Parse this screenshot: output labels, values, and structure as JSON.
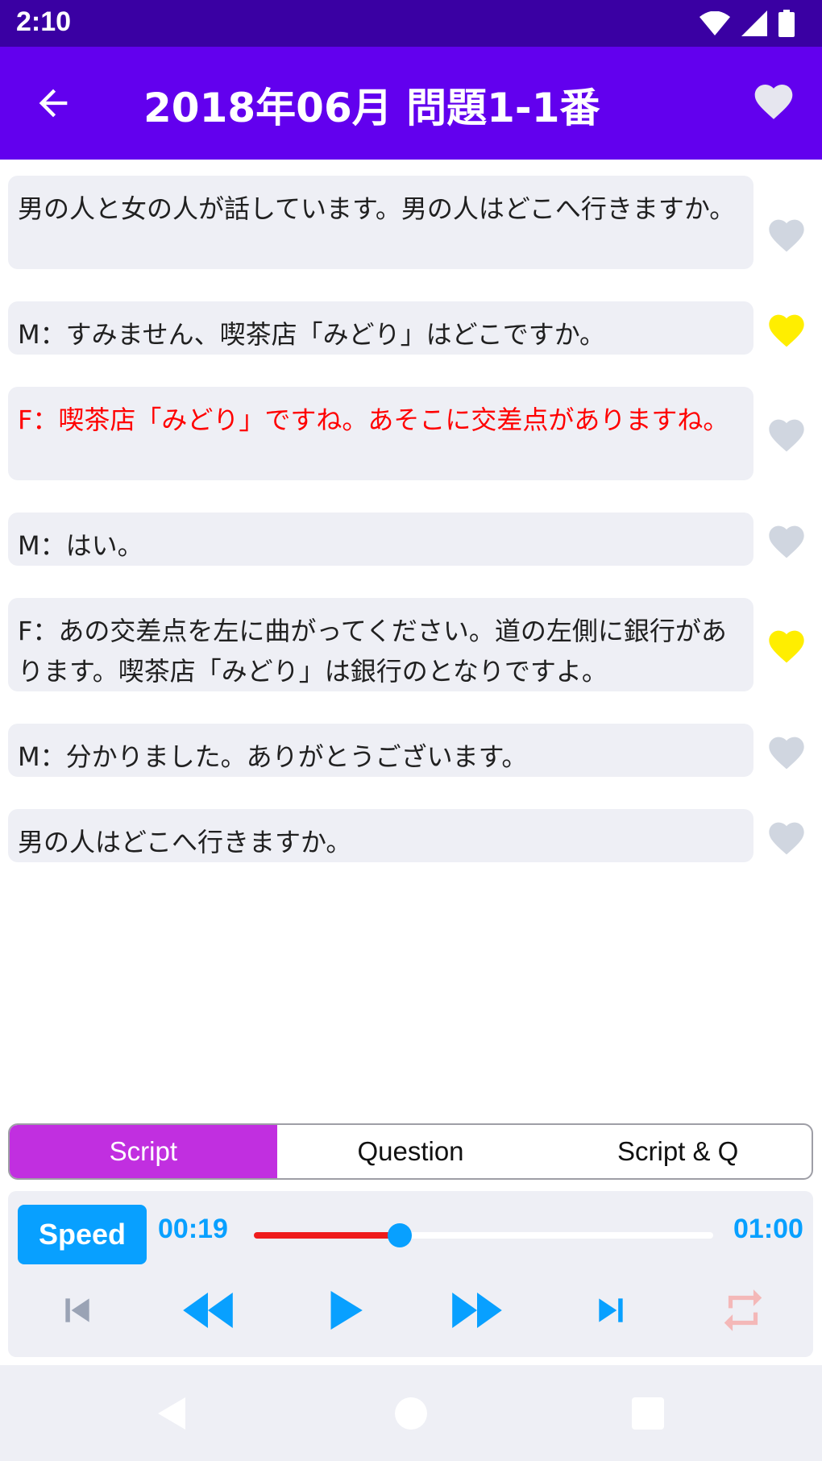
{
  "status": {
    "time": "2:10"
  },
  "header": {
    "title": "2018年06月 問題1-1番"
  },
  "script_lines": [
    {
      "text": "男の人と女の人が話しています。男の人はどこへ行きますか。",
      "favorite": false,
      "highlighted": false
    },
    {
      "text": "M：すみません、喫茶店「みどり」はどこですか。",
      "favorite": true,
      "highlighted": false
    },
    {
      "text": "F：喫茶店「みどり」ですね。あそこに交差点がありますね。",
      "favorite": false,
      "highlighted": true
    },
    {
      "text": "M：はい。",
      "favorite": false,
      "highlighted": false
    },
    {
      "text": "F：あの交差点を左に曲がってください。道の左側に銀行があります。喫茶店「みどり」は銀行のとなりですよ。",
      "favorite": true,
      "highlighted": false
    },
    {
      "text": "M：分かりました。ありがとうございます。",
      "favorite": false,
      "highlighted": false
    },
    {
      "text": "男の人はどこへ行きますか。",
      "favorite": false,
      "highlighted": false
    }
  ],
  "tabs": [
    {
      "label": "Script",
      "active": true
    },
    {
      "label": "Question",
      "active": false
    },
    {
      "label": "Script & Q",
      "active": false
    }
  ],
  "player": {
    "speed_label": "Speed",
    "current_time": "00:19",
    "total_time": "01:00",
    "progress": 0.317
  },
  "colors": {
    "accent": "#6200ee",
    "status_bar": "#3a00a3",
    "heart_on": "#ffee00",
    "heart_off": "#d0d6e0",
    "highlight_text": "#ff0000",
    "player_blue": "#08a0ff"
  },
  "icons": {
    "back": "arrow-back-icon",
    "favorite": "heart-icon",
    "skip_previous": "skip-previous-icon",
    "rewind": "fast-rewind-icon",
    "play": "play-icon",
    "forward": "fast-forward-icon",
    "skip_next": "skip-next-icon",
    "repeat": "repeat-icon"
  }
}
